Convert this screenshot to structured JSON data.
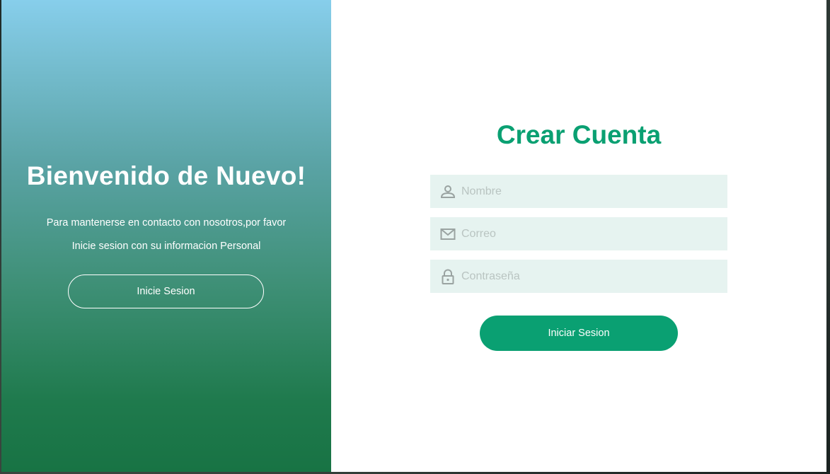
{
  "welcome": {
    "title": "Bienvenido de Nuevo!",
    "line1": "Para mantenerse en contacto con nosotros,por favor",
    "line2": "Inicie sesion con su informacion Personal",
    "button_label": "Inicie Sesion"
  },
  "signup": {
    "title": "Crear Cuenta",
    "fields": [
      {
        "placeholder": "Nombre",
        "icon": "user-icon"
      },
      {
        "placeholder": "Correo",
        "icon": "envelope-icon"
      },
      {
        "placeholder": "Contraseña",
        "icon": "lock-icon"
      }
    ],
    "submit_label": "Iniciar Sesion"
  },
  "colors": {
    "accent": "#0aa072",
    "field_bg": "#e6f3f0",
    "gradient_top": "#87ceeb",
    "gradient_bottom": "#187344"
  }
}
